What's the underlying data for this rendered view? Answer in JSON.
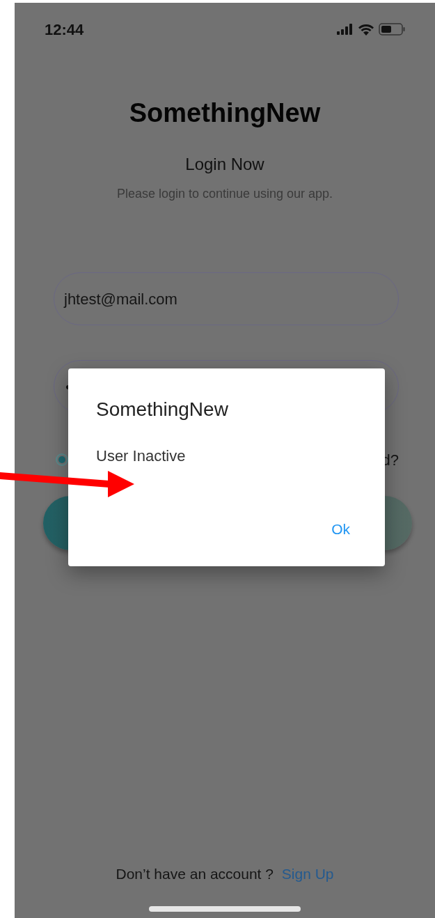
{
  "status_bar": {
    "time": "12:44"
  },
  "app_title": "SomethingNew",
  "heading": "Login Now",
  "subtitle": "Please login to continue using our app.",
  "email_field": {
    "value": "jhtest@mail.com"
  },
  "password_field": {
    "value": "•"
  },
  "remember_radio": {
    "selected": true
  },
  "forgot_link": "d?",
  "dialog": {
    "title": "SomethingNew",
    "message": "User Inactive",
    "buttons": [
      "Ok"
    ]
  },
  "footer": {
    "text": "Don’t have an account ?",
    "link": "Sign Up"
  }
}
